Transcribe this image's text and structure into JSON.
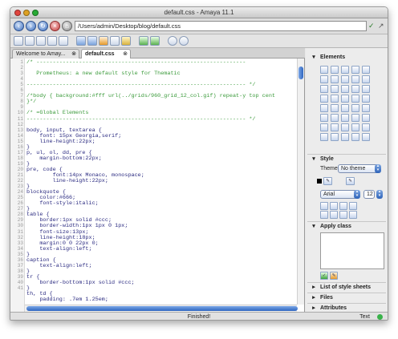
{
  "window": {
    "title": "default.css - Amaya 11.1",
    "traffic_light_colors": [
      "#e0443e",
      "#dea123",
      "#27aa35"
    ]
  },
  "urlbar": {
    "back_icon": "back-arrow-icon",
    "forward_icon": "forward-arrow-icon",
    "reload_icon": "reload-icon",
    "stop_icon": "stop-icon",
    "home_icon": "home-icon",
    "url": "/Users/admin/Desktop/blog/default.css"
  },
  "toolbar": {
    "icons": [
      "new-document-icon",
      "open-icon",
      "save-icon",
      "save-all-icon",
      "print-icon",
      "undo-icon",
      "redo-icon",
      "cut-icon",
      "copy-icon",
      "paste-icon",
      "spellcheck-icon",
      "transform-icon",
      "zoom-in-icon",
      "zoom-out-icon"
    ]
  },
  "tabs": [
    {
      "label": "Welcome to Amay..."
    },
    {
      "label": "default.css"
    }
  ],
  "editor": {
    "line_numbers": [
      "1",
      "2",
      "3",
      "4",
      "5",
      "6",
      "7",
      "8",
      "9",
      "10",
      "11",
      "12",
      "13",
      "14",
      "15",
      "16",
      "17",
      "18",
      "19",
      "20",
      "21",
      "22",
      "23",
      "24",
      "25",
      "26",
      "27",
      "28",
      "29",
      "30",
      "31",
      "32",
      "33",
      "34",
      "35",
      "36",
      "37",
      "38",
      "39",
      "40",
      "41"
    ],
    "lines": [
      "/* ----------------------------------------------------------------",
      "",
      "   Prometheus: a new default style for Thematic",
      "",
      "------------------------------------------------------------------- */",
      "",
      "/*body { background:#fff url(../grids/960_grid_12_col.gif) repeat-y top cent",
      "}*/",
      "",
      "/* =Global Elements",
      "------------------------------------------------------------------- */",
      "",
      "body, input, textarea {",
      "    font: 15px Georgia,serif;",
      "    line-height:22px;",
      "}",
      "p, ul, ol, dd, pre {",
      "    margin-bottom:22px;",
      "}",
      "pre, code {",
      "        font:14px Monaco, monospace;",
      "        line-height:22px;",
      "}",
      "blockquote {",
      "    color:#666;",
      "    font-style:italic;",
      "}",
      "table {",
      "    border:1px solid #ccc;",
      "    border-width:1px 1px 0 1px;",
      "    font-size:13px;",
      "    line-height:18px;",
      "    margin:0 0 22px 0;",
      "    text-align:left;",
      "}",
      "caption {",
      "    text-align:left;",
      "}",
      "tr {",
      "    border-bottom:1px solid #ccc;",
      "}",
      "th, td {",
      "    padding: .7em 1.25em;"
    ],
    "comment_color": "#3a9a3a",
    "code_color": "#2a2a80"
  },
  "status": {
    "message": "Finished!",
    "mode": "Text"
  },
  "panel": {
    "elements": {
      "title": "Elements"
    },
    "style": {
      "title": "Style",
      "theme_label": "Theme",
      "theme_value": "No theme"
    },
    "font": {
      "family": "Arial",
      "size": "12"
    },
    "apply_class": {
      "title": "Apply class"
    },
    "list_style_sheets": {
      "title": "List of style sheets"
    },
    "files": {
      "title": "Files"
    },
    "attributes": {
      "title": "Attributes"
    }
  }
}
